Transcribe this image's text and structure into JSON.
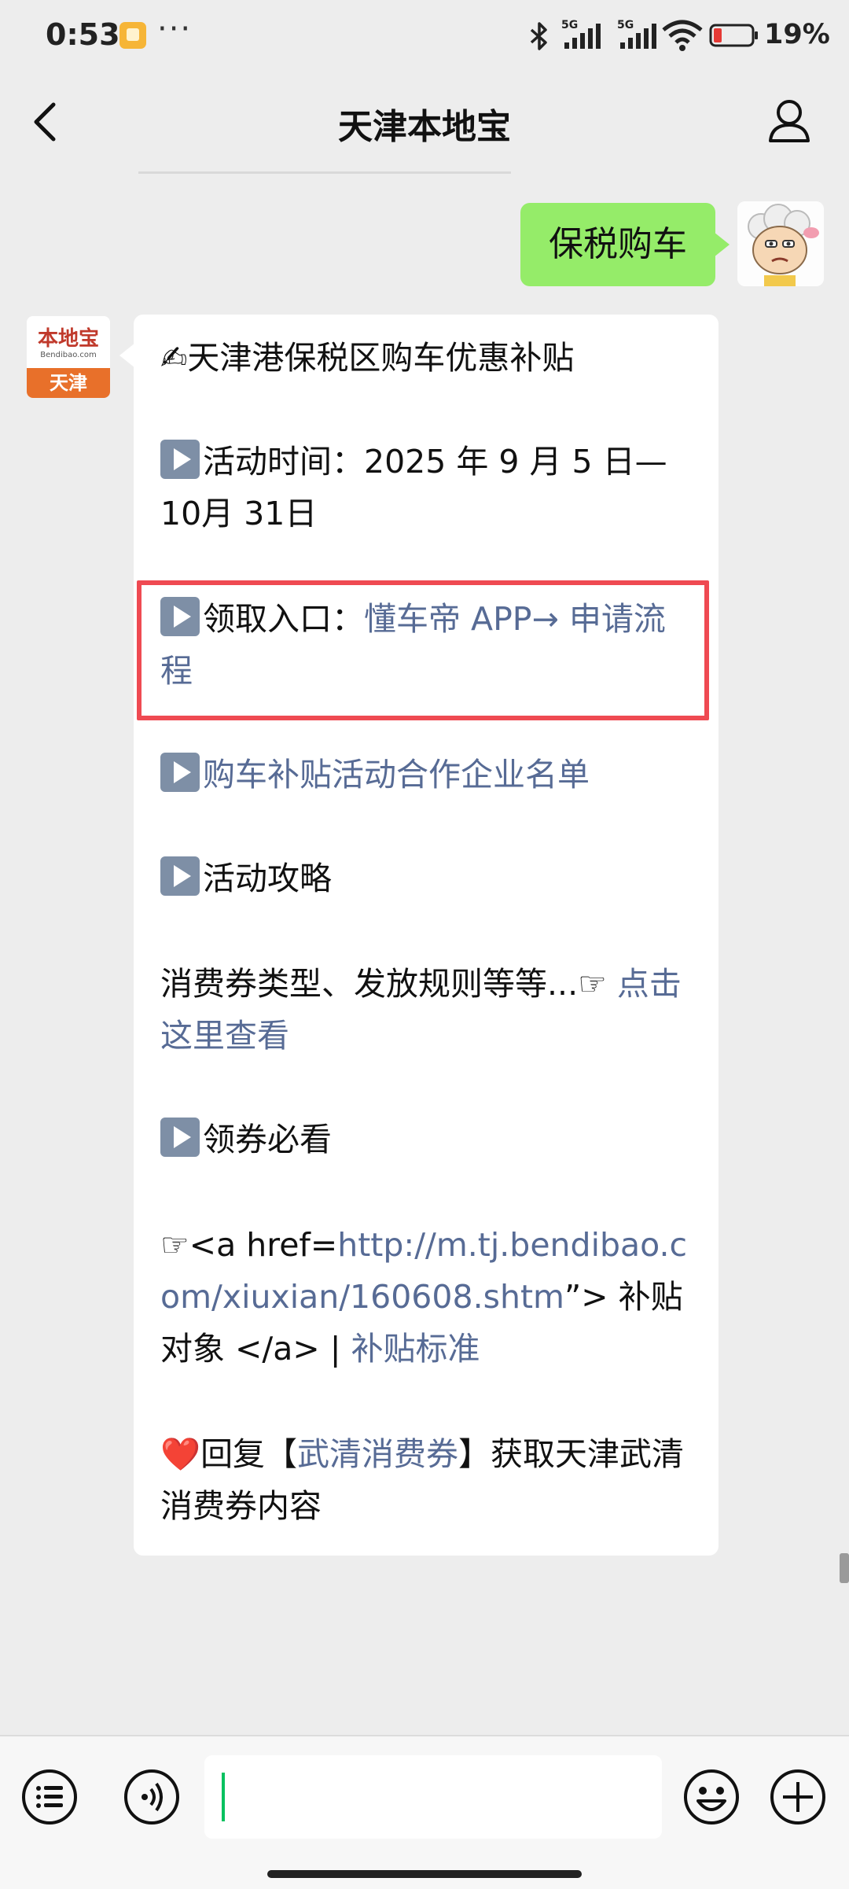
{
  "status_bar": {
    "time": "0:53",
    "dots": "···",
    "battery_percent": "19%",
    "network_labels": [
      "5G",
      "5G"
    ]
  },
  "header": {
    "title": "天津本地宝"
  },
  "user_message": {
    "text": "保税购车"
  },
  "bot": {
    "avatar_logo_text": "本地宝",
    "avatar_logo_sub": "Bendibao.com",
    "avatar_band_text": "天津"
  },
  "bot_message": {
    "heading": "✍天津港保税区购车优惠补贴",
    "activity_time": "活动时间：2025 年 9 月 5 日—10月 31日",
    "entry_label": "领取入口：",
    "entry_link": "懂车帝 APP→ 申请流程",
    "partner_list_link": "购车补贴活动合作企业名单",
    "guide_label": "活动攻略",
    "coupon_types_text": "消费券类型、发放规则等等...☞ ",
    "coupon_types_link": "点击这里查看",
    "must_read_label": "领券必看",
    "raw_prefix": "☞<a href=",
    "raw_url": "http://m.tj.bendibao.com/xiuxian/160608.shtm",
    "raw_suffix": "”> 补贴对象 </a> | ",
    "standard_link": "补贴标准",
    "reply_heart": "❤️",
    "reply_prefix": "回复【",
    "reply_keyword": "武清消费券",
    "reply_suffix": "】获取天津武清消费券内容"
  },
  "colors": {
    "background": "#ededed",
    "user_bubble": "#95ec69",
    "link": "#576b95",
    "highlight_box": "#ef4a52",
    "avatar_band": "#e8702a",
    "cursor": "#07c160"
  },
  "icons": [
    "back-arrow-icon",
    "profile-icon",
    "menu-list-icon",
    "voice-icon",
    "emoji-icon",
    "plus-icon",
    "bluetooth-icon",
    "signal-icon",
    "wifi-icon",
    "battery-icon"
  ]
}
